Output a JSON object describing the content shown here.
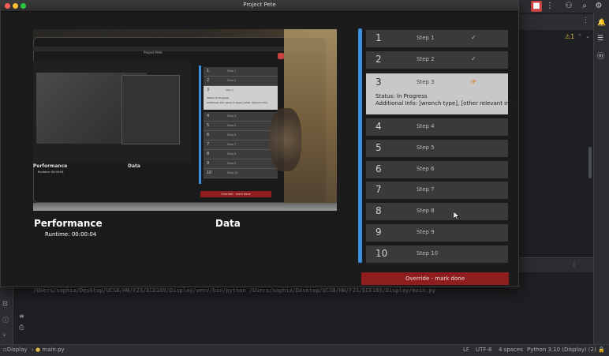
{
  "window": {
    "title": "Project Pete"
  },
  "performance": {
    "title": "Performance",
    "runtime": "Runtime: 00:00:04"
  },
  "data_section": {
    "title": "Data"
  },
  "photo": {
    "mini_steps": [
      {
        "num": "1",
        "label": "Step 1"
      },
      {
        "num": "2",
        "label": "Step 2"
      },
      {
        "num": "4",
        "label": "Step 4"
      },
      {
        "num": "5",
        "label": "Step 5"
      },
      {
        "num": "6",
        "label": "Step 6"
      },
      {
        "num": "7",
        "label": "Step 7"
      },
      {
        "num": "8",
        "label": "Step 8"
      },
      {
        "num": "9",
        "label": "Step 9"
      },
      {
        "num": "10",
        "label": "Step 10"
      }
    ],
    "mini_step3": {
      "num": "3",
      "label": "Step 3",
      "status": "Status: In Progress",
      "info": "Additional Info: [wrench type], [other relevant info]"
    },
    "mini_override": "Override - mark done",
    "mini_title": "Project Pete",
    "mini_perf": "Performance",
    "mini_runtime": "Runtime: 00:00:04",
    "mini_data": "Data"
  },
  "steps": [
    {
      "num": "1",
      "label": "Step 1",
      "check": "✓"
    },
    {
      "num": "2",
      "label": "Step 2",
      "check": "✓"
    },
    {
      "num": "4",
      "label": "Step 4",
      "check": ""
    },
    {
      "num": "5",
      "label": "Step 5",
      "check": ""
    },
    {
      "num": "6",
      "label": "Step 6",
      "check": ""
    },
    {
      "num": "7",
      "label": "Step 7",
      "check": ""
    },
    {
      "num": "8",
      "label": "Step 8",
      "check": ""
    },
    {
      "num": "9",
      "label": "Step 9",
      "check": ""
    },
    {
      "num": "10",
      "label": "Step 10",
      "check": ""
    }
  ],
  "current_step": {
    "num": "3",
    "label": "Step 3",
    "badge": "IP",
    "status": "Status: In Progress",
    "info": "Additional Info: [wrench type], [other relevant info]"
  },
  "override_button": "Override - mark done",
  "ide": {
    "console_line": "/Users/sophia/Desktop/UCSB/HW/F23/ECE189/Display/venv/bin/python /Users/sophia/Desktop/UCSB/HW/F23/ECE189/Display/main.py",
    "warning_count": "1",
    "status": {
      "project": "Display",
      "file": "main.py",
      "line_ending": "LF",
      "encoding": "UTF-8",
      "indent": "4 spaces",
      "interpreter": "Python 3.10 (Display) (2)"
    }
  },
  "colors": {
    "accent_blue": "#3d8fe0",
    "override_red": "#8e1d1d",
    "in_progress": "#d47a1a"
  }
}
